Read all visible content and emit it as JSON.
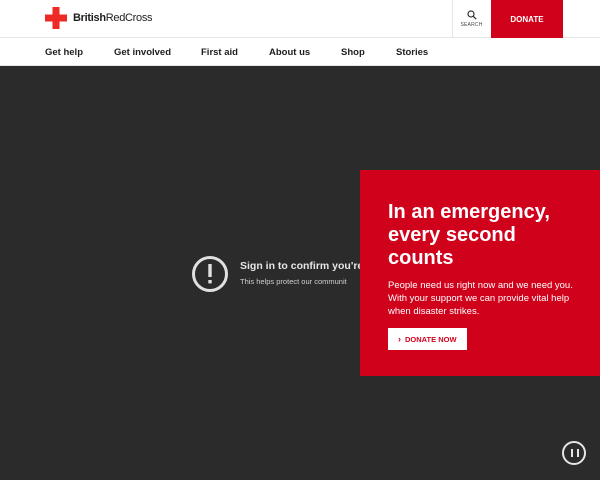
{
  "header": {
    "logo": {
      "text_bold": "British",
      "text_light": "RedCross",
      "icon": "red-cross-icon",
      "color": "#ee2a24"
    },
    "search": {
      "label": "SEARCH",
      "icon": "search-icon"
    },
    "donate_label": "DONATE"
  },
  "nav": {
    "items": [
      {
        "label": "Get help"
      },
      {
        "label": "Get involved"
      },
      {
        "label": "First aid"
      },
      {
        "label": "About us"
      },
      {
        "label": "Shop"
      },
      {
        "label": "Stories"
      }
    ]
  },
  "video": {
    "signin_title": "Sign in to confirm you're n",
    "signin_sub": "This helps protect our communit",
    "alert_icon": "exclamation-circle-icon",
    "pause_icon": "pause-icon"
  },
  "promo": {
    "title": "In an emergency, every second counts",
    "body": "People need us right now and we need you. With your support we can provide vital help when disaster strikes.",
    "button_label": "DONATE NOW",
    "button_icon": "chevron-right-icon",
    "background": "#d0021b"
  }
}
